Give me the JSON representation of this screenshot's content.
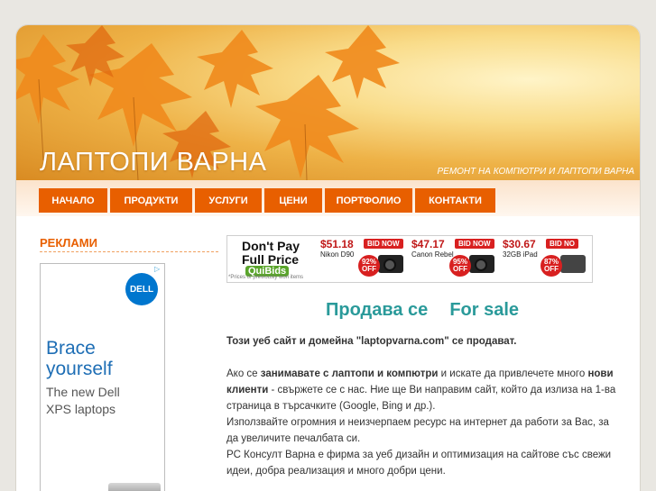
{
  "header": {
    "title": "ЛАПТОПИ ВАРНА",
    "tagline": "РЕМОНТ НА КОМПЮТРИ И ЛАПТОПИ ВАРНА"
  },
  "nav": {
    "items": [
      {
        "label": "НАЧАЛО"
      },
      {
        "label": "ПРОДУКТИ"
      },
      {
        "label": "УСЛУГИ"
      },
      {
        "label": "ЦЕНИ"
      },
      {
        "label": "ПОРТФОЛИО"
      },
      {
        "label": "КОНТАКТИ"
      }
    ]
  },
  "sidebar": {
    "title": "РЕКЛАМИ",
    "ad": {
      "logo": "DELL",
      "headline_1": "Brace",
      "headline_2": "yourself",
      "sub_1": "The new Dell",
      "sub_2": "XPS laptops"
    }
  },
  "banner": {
    "line1": "Don't Pay",
    "line2": "Full Price",
    "brand": "QuiBids",
    "fine_print": "*Prices of previously won items",
    "products": [
      {
        "price": "$51.18",
        "name": "Nikon D90",
        "bid": "BID NOW",
        "off": "92% OFF"
      },
      {
        "price": "$47.17",
        "name": "Canon Rebel",
        "bid": "BID NOW",
        "off": "95% OFF"
      },
      {
        "price": "$30.67",
        "name": "32GB iPad",
        "bid": "BID NO",
        "off": "87% OFF"
      }
    ]
  },
  "main": {
    "sale_bg": "Продава се",
    "sale_en": "For sale",
    "intro": "Този уеб сайт и домейна \"laptopvarna.com\" се продават.",
    "p1_a": "Ако се ",
    "p1_b": "занимавате с лаптопи и компютри",
    "p1_c": "  и искате да привлечете много  ",
    "p1_d": "нови клиенти",
    "p1_e": " - свържете се с нас. Ние ще Ви направим сайт, който да излиза на 1-ва страница в търсачките (Google, Bing и др.).",
    "p2": "Използвайте огромния и неизчерпаем ресурс на интернет да работи за Вас, за да увеличите печалбата си.",
    "p3": "PC Консулт Варна е фирма за уеб дизайн и оптимизация на сайтове със свежи идеи, добра реализация и много добри цени."
  },
  "colors": {
    "accent": "#e85f00",
    "teal": "#2a9a9a",
    "dell_blue": "#1e6eb5"
  }
}
